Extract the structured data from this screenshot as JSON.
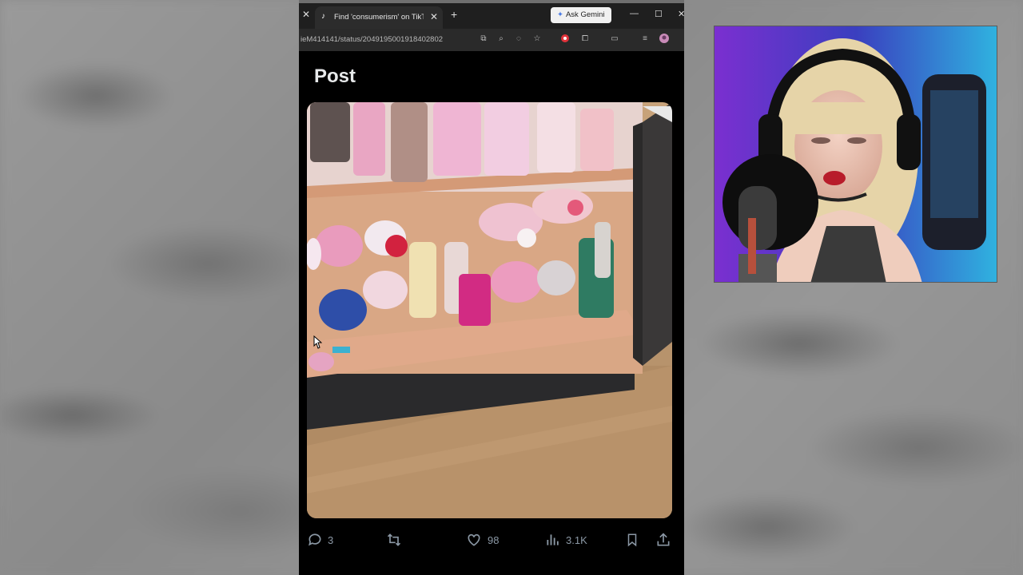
{
  "browser": {
    "tab_title": "Find 'consumerism' on TikTok |",
    "new_tab_label": "+",
    "ask_gemini_label": "Ask Gemini",
    "url": "ieM414141/status/2049195001918402802"
  },
  "post": {
    "header_title": "Post",
    "actions": {
      "replies": "3",
      "likes": "98",
      "views": "3.1K"
    }
  },
  "colors": {
    "accent": "#1d9bf0",
    "icon_grey": "#8b98a5"
  }
}
